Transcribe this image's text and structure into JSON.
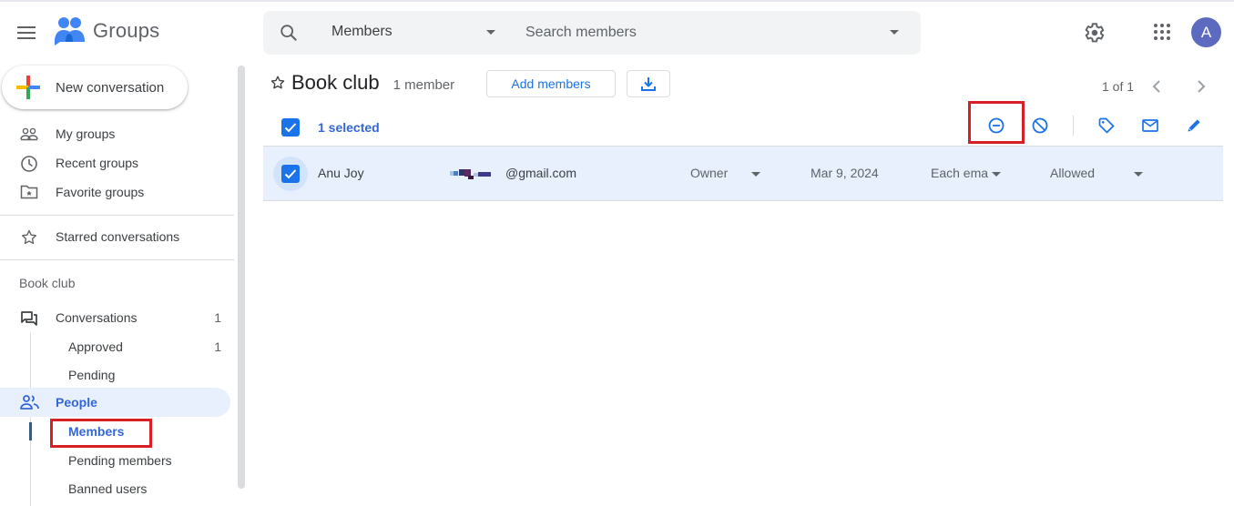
{
  "app": {
    "name": "Groups",
    "menu_icon": "hamburger-menu-icon",
    "logo_icon": "groups-logo-icon"
  },
  "search": {
    "scope": "Members",
    "placeholder": "Search members",
    "value": ""
  },
  "header": {
    "settings_icon": "gear-icon",
    "apps_icon": "apps-grid-icon",
    "avatar_initial": "A",
    "avatar_color": "#5c6bc0"
  },
  "sidebar": {
    "new_conversation": "New conversation",
    "nav": [
      {
        "label": "My groups",
        "icon": "people-outline-icon"
      },
      {
        "label": "Recent groups",
        "icon": "clock-icon"
      },
      {
        "label": "Favorite groups",
        "icon": "star-folder-icon"
      }
    ],
    "starred": {
      "label": "Starred conversations",
      "icon": "star-icon"
    },
    "group_name": "Book club",
    "group_items": {
      "conversations": {
        "label": "Conversations",
        "count": "1",
        "icon": "forum-icon"
      },
      "approved": {
        "label": "Approved",
        "count": "1"
      },
      "pending": {
        "label": "Pending"
      },
      "people": {
        "label": "People",
        "icon": "people-icon"
      },
      "members": {
        "label": "Members"
      },
      "pending_members": {
        "label": "Pending members"
      },
      "banned_users": {
        "label": "Banned users"
      }
    }
  },
  "main": {
    "title": "Book club",
    "member_count": "1 member",
    "add_members": "Add members",
    "download_icon": "download-icon",
    "pager": "1 of 1",
    "selection_text": "1 selected",
    "actions": [
      {
        "name": "remove-member",
        "icon": "remove-circle-icon"
      },
      {
        "name": "ban-member",
        "icon": "block-icon"
      },
      {
        "name": "label",
        "icon": "tag-icon"
      },
      {
        "name": "email",
        "icon": "mail-icon"
      },
      {
        "name": "edit",
        "icon": "pencil-icon"
      }
    ],
    "members": [
      {
        "name": "Anu Joy",
        "email": "@gmail.com",
        "role": "Owner",
        "joined": "Mar 9, 2024",
        "delivery": "Each ema",
        "posting": "Allowed",
        "selected": true
      }
    ]
  },
  "colors": {
    "accent": "#1a73e8",
    "accent_text": "#3367d6",
    "selected_row": "#e8f0fe",
    "highlight_box": "#d61f26"
  }
}
